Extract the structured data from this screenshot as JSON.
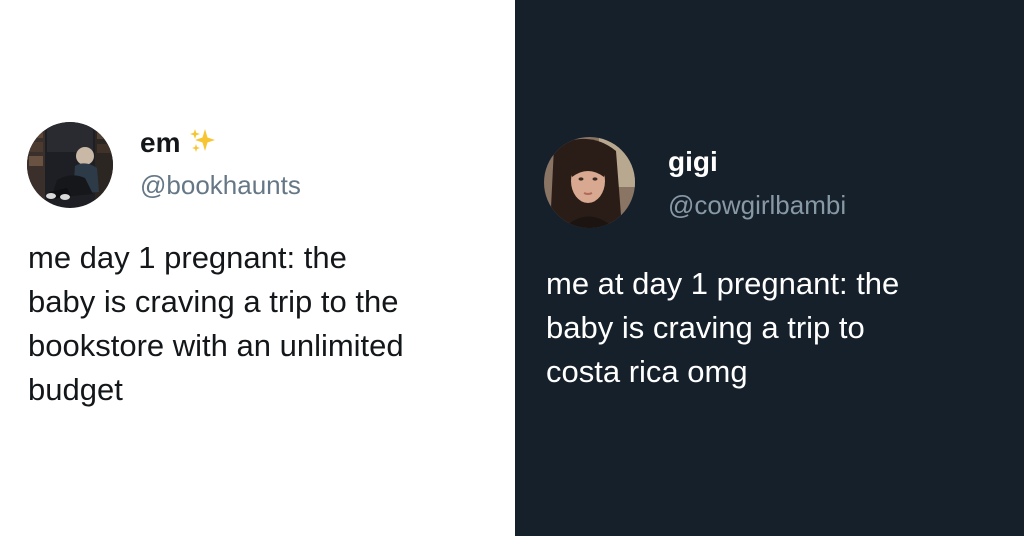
{
  "left_tweet": {
    "display_name": "em",
    "handle": "@bookhaunts",
    "lines": [
      "me day 1 pregnant: the",
      "baby is craving a trip to the",
      "bookstore with an unlimited",
      "budget"
    ],
    "name_emoji_icon": "sparkles-icon",
    "background": "#ffffff"
  },
  "right_tweet": {
    "display_name": "gigi",
    "handle": "@cowgirlbambi",
    "lines": [
      "me at day 1 pregnant: the",
      "baby is craving a trip to",
      "costa rica omg"
    ],
    "background": "#15202b"
  }
}
